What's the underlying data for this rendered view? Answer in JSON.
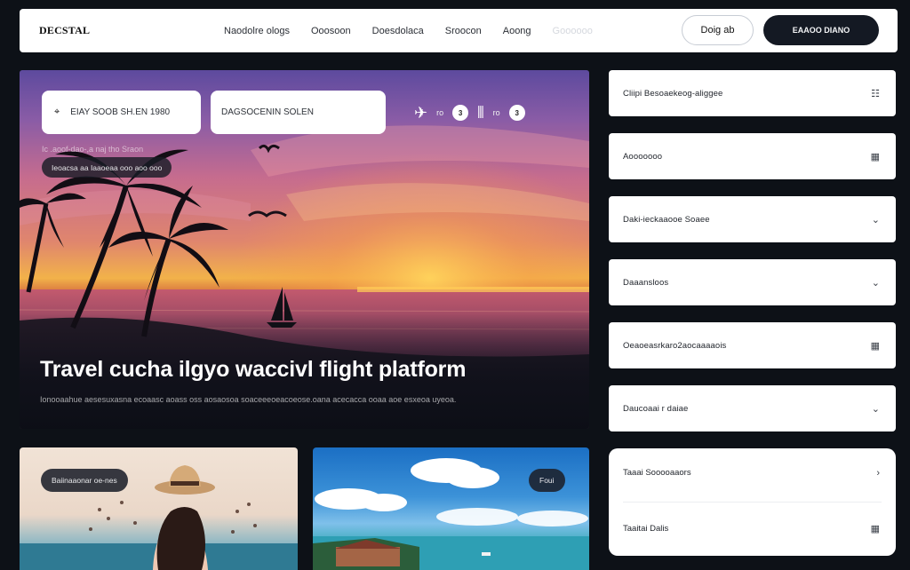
{
  "header": {
    "logo": "DECSTAL",
    "nav": [
      "Naodolre ologs",
      "Ooosoon",
      "Doesdolaca",
      "Sroocon",
      "Aoong",
      "Goooooo"
    ],
    "login_label": "Doig ab",
    "cta_label": "EAAOO DIANO"
  },
  "hero": {
    "search_from_placeholder": "EIAY SOOB SH.EN 1980",
    "search_to_placeholder": "DAGSOCENIN SOLEN",
    "icon_count_1": "3",
    "icon_count_2": "3",
    "icon_text_1": "ro",
    "icon_text_2": "ro",
    "sub_line": "Ic  .aoof-dao-,a  naj tho  Sraon",
    "pill_label": "Ieoacsa aa  Iaaoeaa  ooo  aoo  ooo",
    "title": "Travel cucha ilgyo waccivl flight platform",
    "description": "Ionooaahue aesesuxasna ecoaasc aoass oss aosaosoa soaceeeoeacoeose.oana acecacca  ooaa aoe esxeoa uyeoa."
  },
  "sidebar": {
    "items": [
      {
        "label": "Cliipi  Besoaekeog-aliggee",
        "icon": "grid-icon",
        "glyph": "☷"
      },
      {
        "label": "Aooooooo",
        "icon": "calendar-icon",
        "glyph": "▦"
      },
      {
        "label": "Daki-ieckaaooe  Soaee",
        "icon": "chevron-down-icon",
        "glyph": "⌄"
      },
      {
        "label": "Daaansloos",
        "icon": "chevron-down-icon",
        "glyph": "⌄"
      },
      {
        "label": "Oeaoeasrkaro2aocaaaaois",
        "icon": "calendar-icon",
        "glyph": "▦"
      },
      {
        "label": "Daucoaai r daiae",
        "icon": "chevron-down-icon",
        "glyph": "⌄"
      }
    ],
    "card_rows": [
      {
        "label": "Taaai  Sooooaaors",
        "icon": "chevron-right-icon",
        "glyph": "›"
      },
      {
        "label": "Taaitai  Dalis",
        "icon": "calendar-icon",
        "glyph": "▦"
      }
    ]
  },
  "cards": {
    "card1_chip": "Baiinaaonar oe-nes",
    "card2_chip": "Foui"
  },
  "colors": {
    "background": "#0d1117",
    "cta": "#141923",
    "card": "#ffffff"
  }
}
